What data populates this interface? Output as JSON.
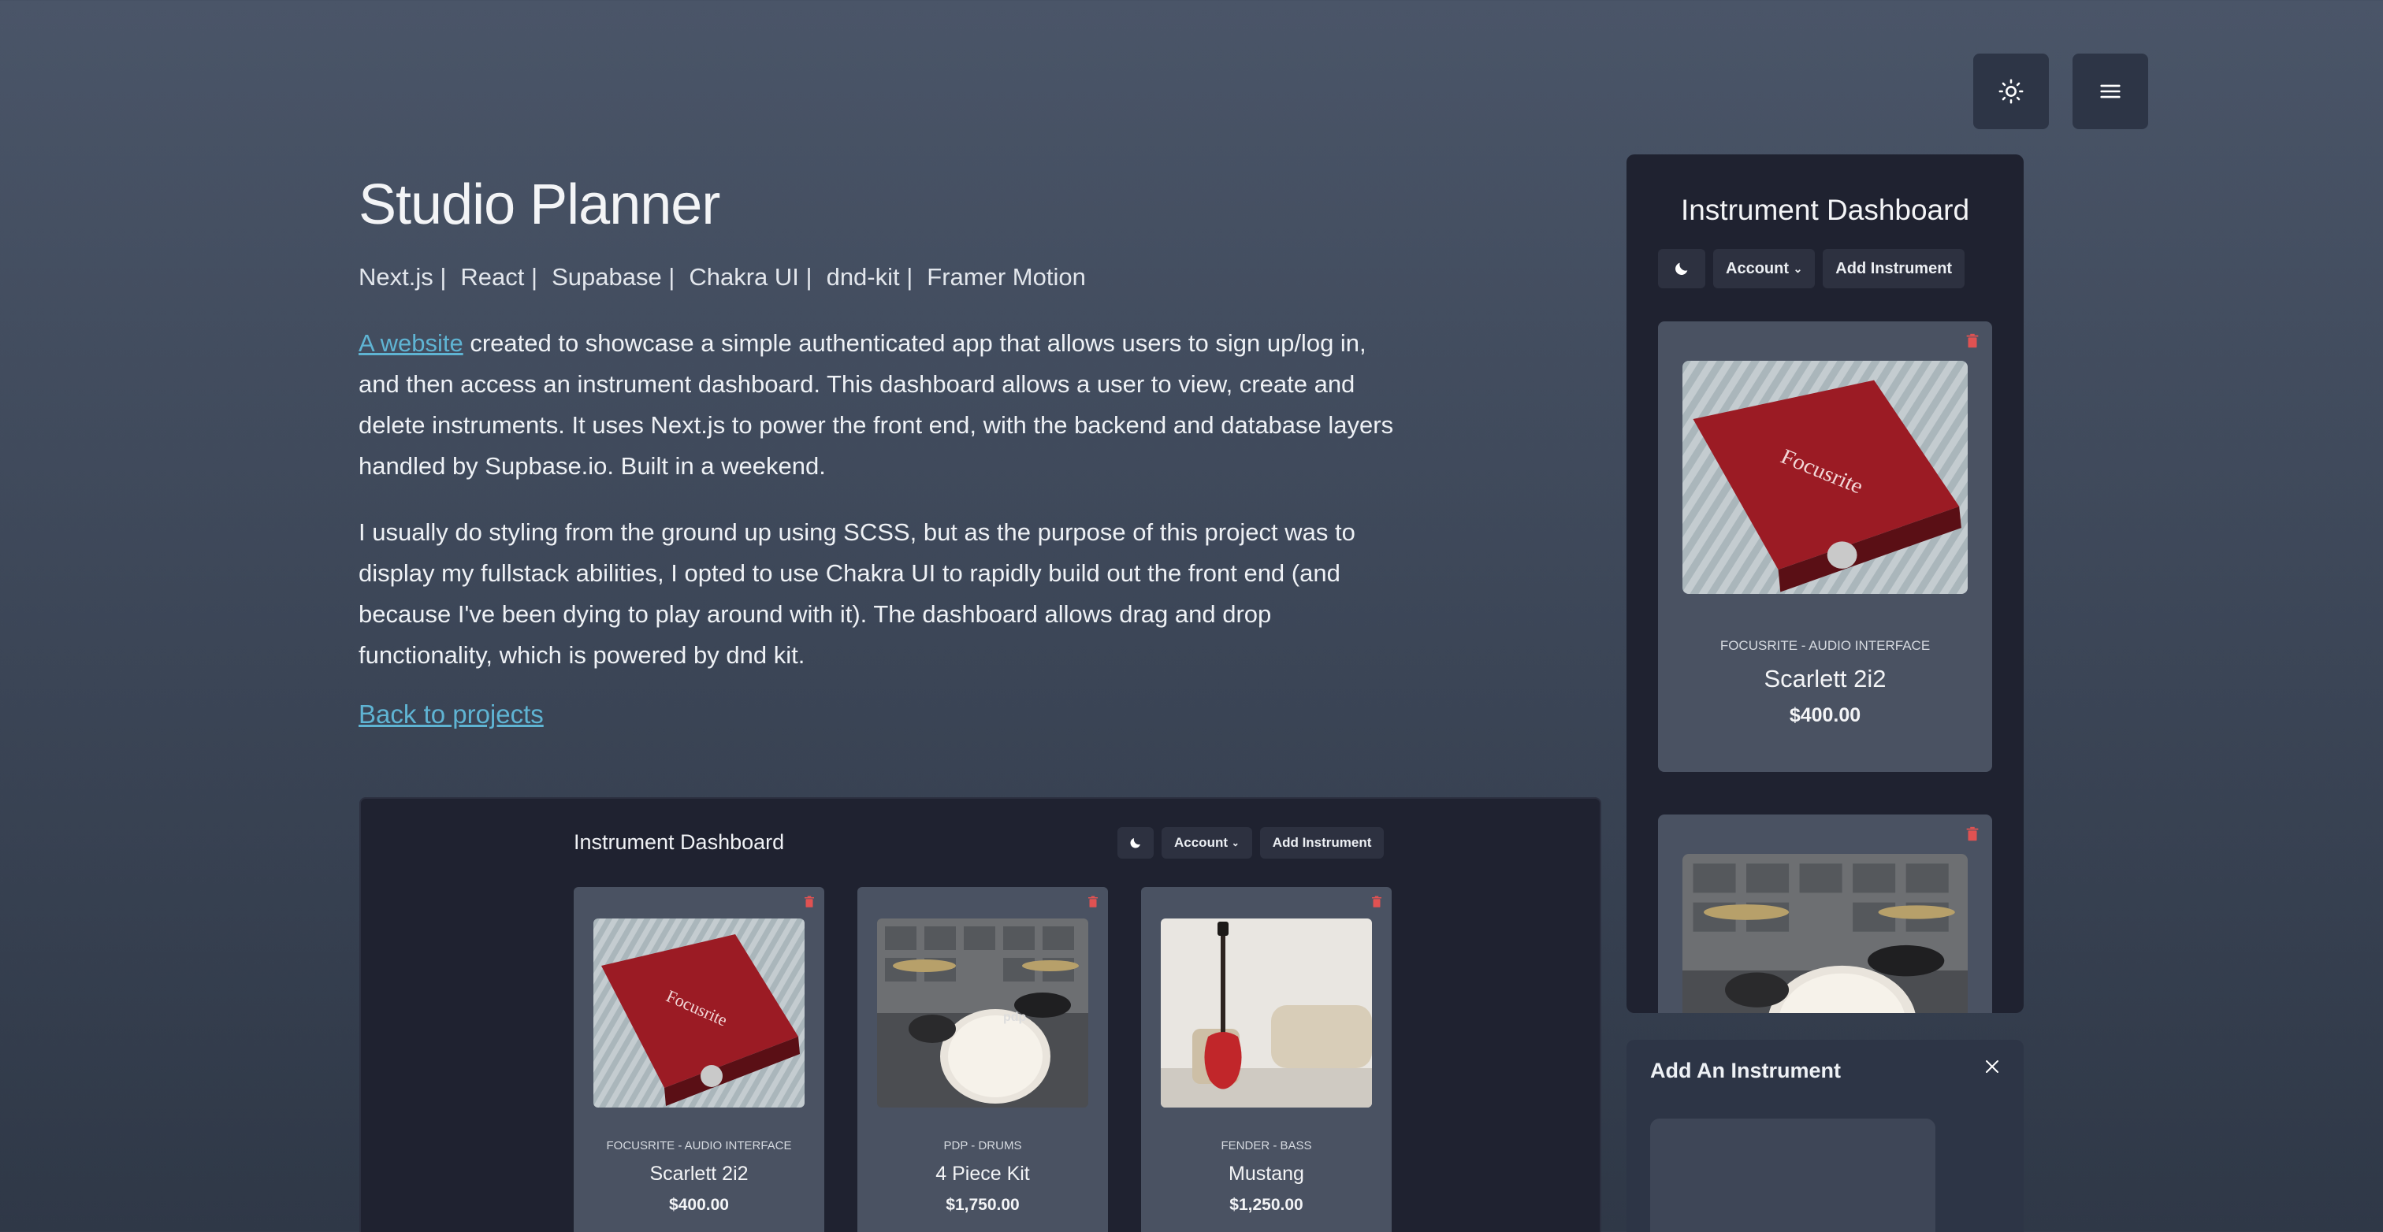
{
  "header": {
    "theme_toggle_icon": "sun-icon",
    "menu_icon": "hamburger-icon"
  },
  "project": {
    "title": "Studio Planner",
    "tech": [
      "Next.js |",
      "React |",
      "Supabase |",
      "Chakra UI |",
      "dnd-kit |",
      "Framer Motion"
    ],
    "para1_link": "A website",
    "para1_rest": " created to showcase a simple authenticated app that allows users to sign up/log in, and then access an instrument dashboard. This dashboard allows a user to view, create and delete instruments. It uses Next.js to power the front end, with the backend and database layers handled by Supbase.io. Built in a weekend.",
    "para2": "I usually do styling from the ground up using SCSS, but as the purpose of this project was to display my fullstack abilities, I opted to use Chakra UI to rapidly build out the front end (and because I've been dying to play around with it). The dashboard allows drag and drop functionality, which is powered by dnd kit.",
    "back_link": "Back to projects"
  },
  "preview": {
    "title": "Instrument Dashboard",
    "account_label": "Account",
    "add_label": "Add Instrument",
    "cards": [
      {
        "brand": "FOCUSRITE - AUDIO INTERFACE",
        "name": "Scarlett 2i2",
        "price": "$400.00",
        "image": "focusrite-interface"
      },
      {
        "brand": "PDP - DRUMS",
        "name": "4 Piece Kit",
        "price": "$1,750.00",
        "image": "drum-kit"
      },
      {
        "brand": "FENDER - BASS",
        "name": "Mustang",
        "price": "$1,250.00",
        "image": "red-bass"
      }
    ]
  },
  "side_dashboard": {
    "title": "Instrument Dashboard",
    "account_label": "Account",
    "add_label": "Add Instrument",
    "cards": [
      {
        "brand": "FOCUSRITE - AUDIO INTERFACE",
        "name": "Scarlett 2i2",
        "price": "$400.00",
        "image": "focusrite-interface"
      },
      {
        "image": "drum-kit"
      }
    ]
  },
  "modal": {
    "title": "Add An Instrument"
  },
  "colors": {
    "link": "#5fb4d3",
    "trash": "#e05252",
    "panel": "#1f2230",
    "card": "#4a5262"
  }
}
